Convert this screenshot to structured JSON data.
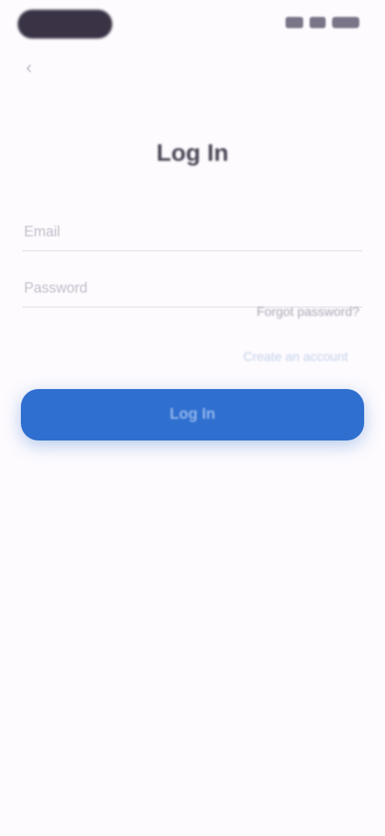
{
  "status_bar": {
    "signal_icon": "signal-icon",
    "wifi_icon": "wifi-icon",
    "battery_icon": "battery-icon"
  },
  "nav": {
    "back_icon": "back-arrow-icon",
    "back_glyph": "‹"
  },
  "page": {
    "title": "Log In"
  },
  "form": {
    "email_placeholder": "Email",
    "password_placeholder": "Password",
    "forgot_label": "Forgot password?",
    "signup_label": "Create an account",
    "submit_label": "Log In"
  },
  "colors": {
    "background": "#fdfbfe",
    "accent": "#2f6fcf"
  }
}
